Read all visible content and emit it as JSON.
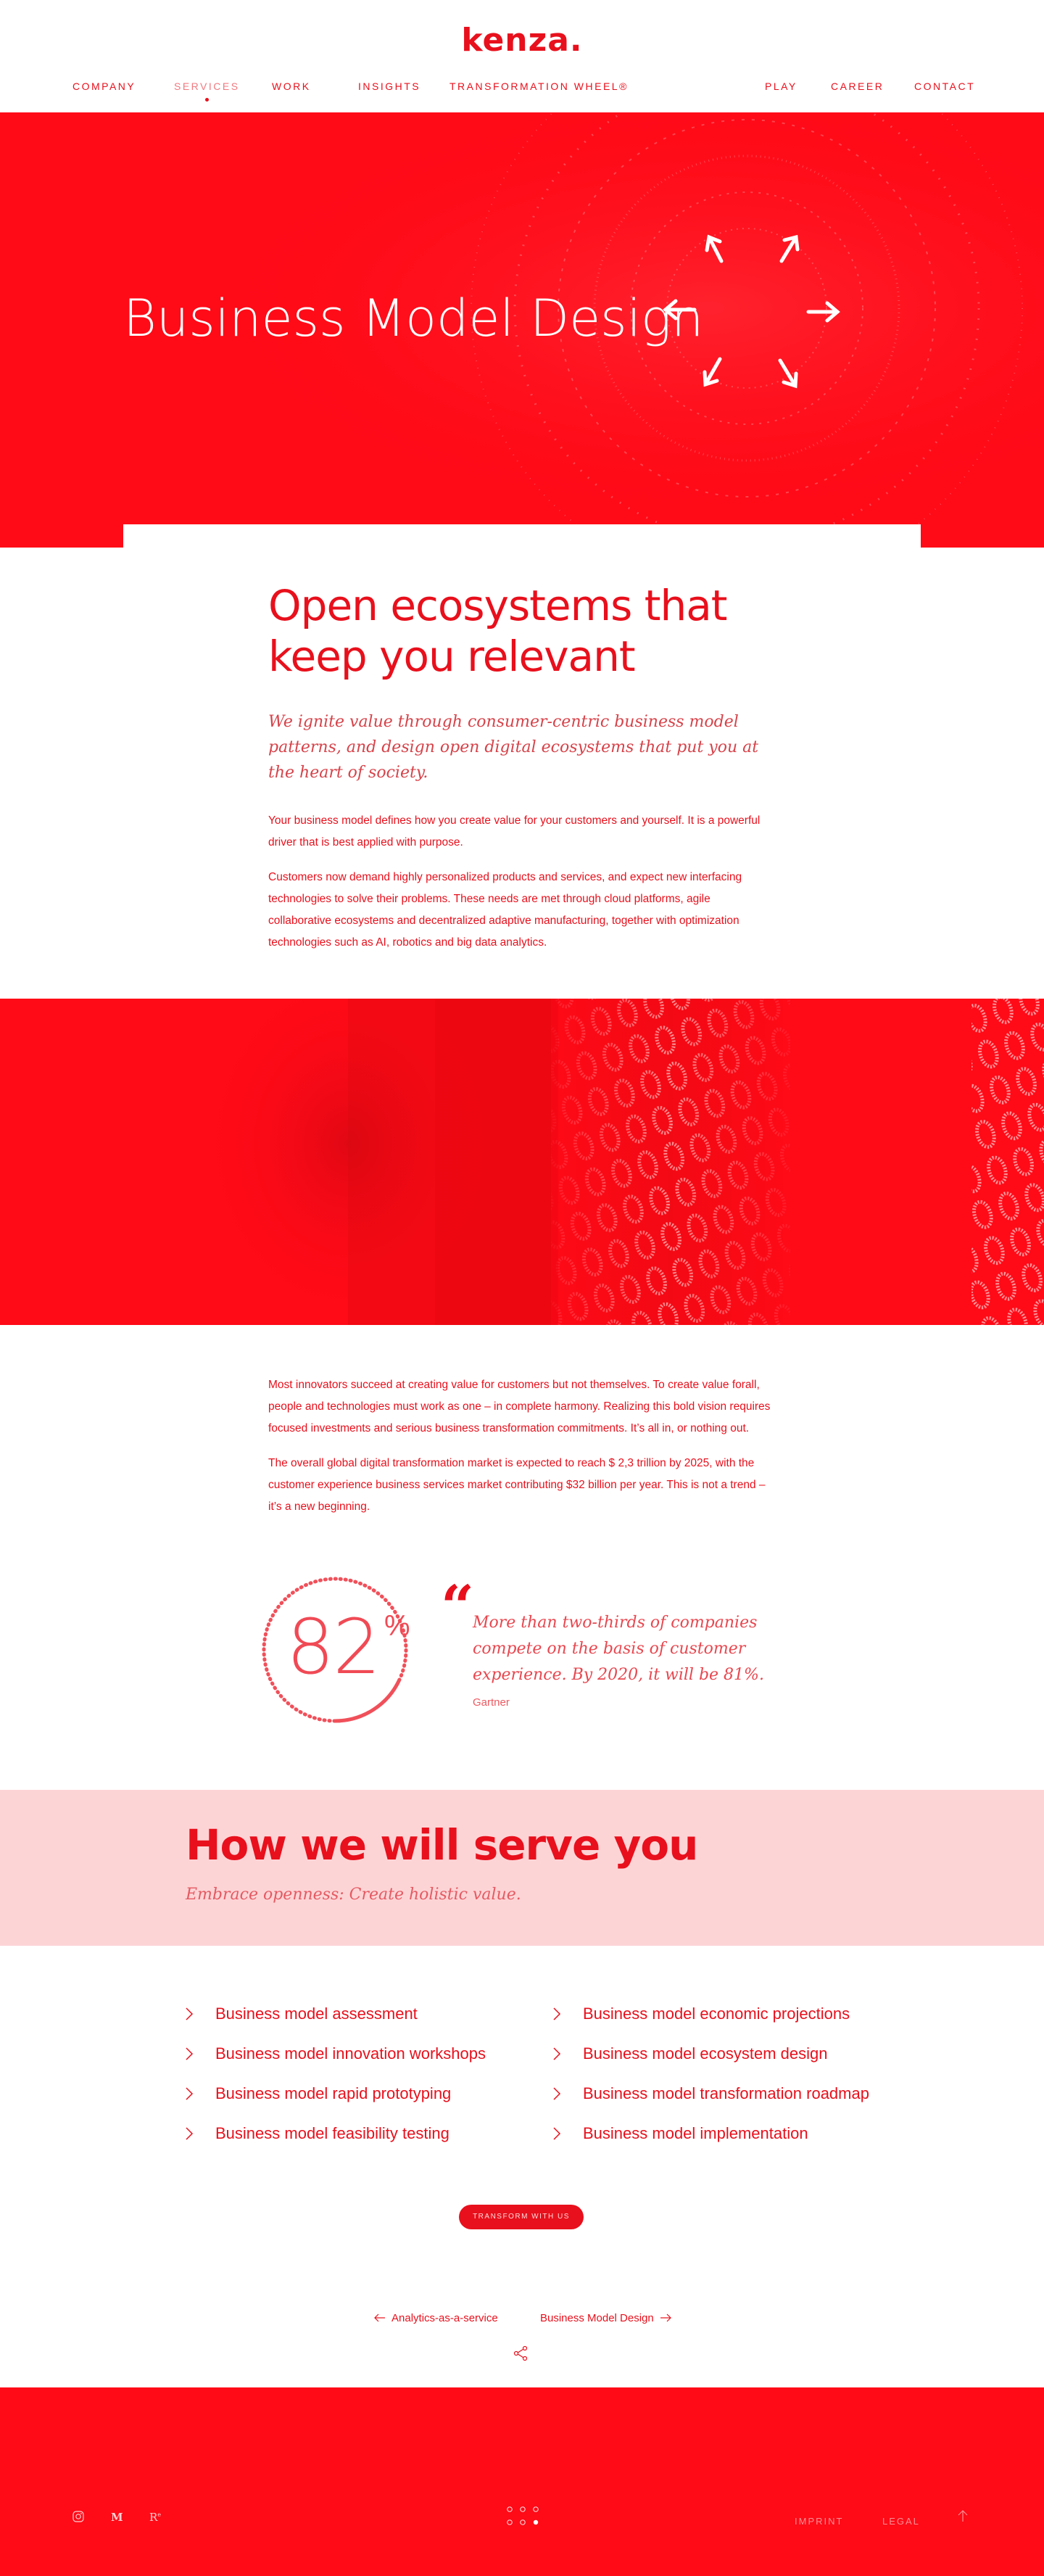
{
  "header": {
    "logo": "kenza.",
    "nav_left": [
      "COMPANY",
      "SERVICES",
      "WORK",
      "INSIGHTS",
      "TRANSFORMATION WHEEL®"
    ],
    "nav_right": [
      "PLAY",
      "CAREER",
      "CONTACT"
    ],
    "active": "SERVICES"
  },
  "hero": {
    "title": "Business Model Design"
  },
  "intro": {
    "heading": "Open ecosystems that keep you relevant",
    "lead": "We ignite value through consumer-centric business model patterns, and design open digital ecosystems that put you at the heart of society.",
    "p1": "Your business model defines how you create value for your customers and yourself. It is a powerful driver that is best applied with purpose.",
    "p2": "Customers now demand highly personalized products and services, and expect new interfacing technologies to solve their problems. These needs are met through cloud platforms, agile collaborative ecosystems and decentralized adaptive manufacturing, together with optimization technologies such as AI, robotics and big data analytics."
  },
  "section2": {
    "p1": "Most innovators succeed at creating value for customers but not themselves. To create value forall, people and technologies must work as one – in complete harmony. Realizing this bold vision requires focused investments and serious business transformation commitments. It’s all in, or nothing out.",
    "p2": "The overall global digital transformation market is expected to reach $ 2,3 trillion by 2025, with the customer experience business services market contributing $32 billion per year. This is not a trend – it’s a new beginning."
  },
  "stat": {
    "value": "82",
    "unit": "%",
    "fraction": 0.82
  },
  "quote": {
    "mark": "“",
    "text": "More than two-thirds of companies compete on the basis of customer experience. By 2020, it will be 81%.",
    "source": "Gartner"
  },
  "serve": {
    "title": "How we will serve you",
    "subtitle": "Embrace openness: Create holistic value."
  },
  "services": {
    "left": [
      "Business model assessment",
      "Business model innovation workshops",
      "Business model rapid prototyping",
      "Business model feasibility testing"
    ],
    "right": [
      "Business model economic projections",
      "Business model ecosystem design",
      "Business model transformation roadmap",
      "Business model implementation"
    ]
  },
  "cta": {
    "label": "TRANSFORM WITH US"
  },
  "pager": {
    "prev": "Analytics-as-a-service",
    "next": "Business Model Design"
  },
  "footer": {
    "social": [
      "instagram-icon",
      "medium-icon",
      "r-icon"
    ],
    "links": [
      "IMPRINT",
      "LEGAL"
    ]
  },
  "colors": {
    "brand_red": "#e8101c",
    "hero_red": "#ff0a17",
    "pink_band": "#fdd4d6"
  }
}
